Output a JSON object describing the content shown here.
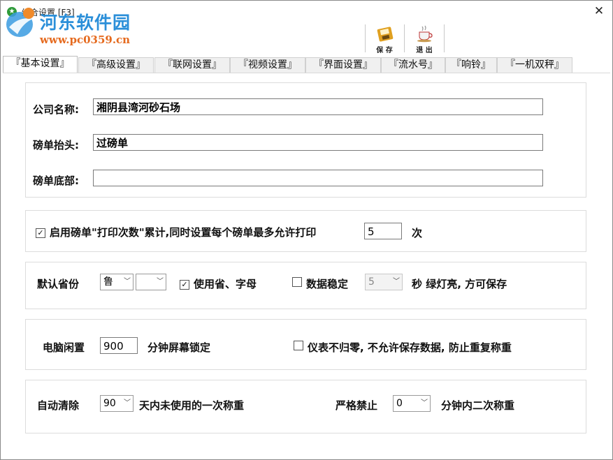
{
  "window": {
    "title": "综合设置 [F3]",
    "close_glyph": "✕"
  },
  "watermark": {
    "name": "河东软件园",
    "url": "www.pc0359.cn"
  },
  "toolbar": {
    "save_label": "保 存",
    "exit_label": "退 出"
  },
  "tabs": [
    {
      "label": "『基本设置』",
      "active": true
    },
    {
      "label": "『高级设置』",
      "active": false
    },
    {
      "label": "『联网设置』",
      "active": false
    },
    {
      "label": "『视频设置』",
      "active": false
    },
    {
      "label": "『界面设置』",
      "active": false
    },
    {
      "label": "『流水号』",
      "active": false
    },
    {
      "label": "『响铃』",
      "active": false
    },
    {
      "label": "『一机双秤』",
      "active": false
    }
  ],
  "company": {
    "name_label": "公司名称:",
    "name_value": "湘阴县湾河砂石场",
    "header_label": "磅单抬头:",
    "header_value": "过磅单",
    "footer_label": "磅单底部:",
    "footer_value": ""
  },
  "print_count": {
    "checked": true,
    "label": "启用磅单\"打印次数\"累计,同时设置每个磅单最多允许打印",
    "value": "5",
    "unit": "次"
  },
  "province": {
    "label": "默认省份",
    "province_value": "鲁",
    "letter_value": "",
    "use_letters_checked": true,
    "use_letters_label": "使用省、字母",
    "stable_checked": false,
    "stable_label": "数据稳定",
    "stable_seconds": "5",
    "stable_suffix": "秒  绿灯亮, 方可保存"
  },
  "idle": {
    "label": "电脑闲置",
    "minutes": "900",
    "suffix": "分钟屏幕锁定",
    "zero_checked": false,
    "zero_label": "仪表不归零, 不允许保存数据, 防止重复称重"
  },
  "cleanup": {
    "label": "自动清除",
    "days": "90",
    "days_suffix": "天内未使用的一次称重",
    "forbid_label": "严格禁止",
    "forbid_minutes": "0",
    "forbid_suffix": "分钟内二次称重"
  },
  "icons": {
    "app": "app-icon",
    "save": "floppy-save-icon",
    "exit": "coffee-cup-exit-icon",
    "dropdown": "chevron-down-icon"
  },
  "colors": {
    "watermark_blue": "#2b8fd9",
    "watermark_orange": "#e56a1e"
  }
}
